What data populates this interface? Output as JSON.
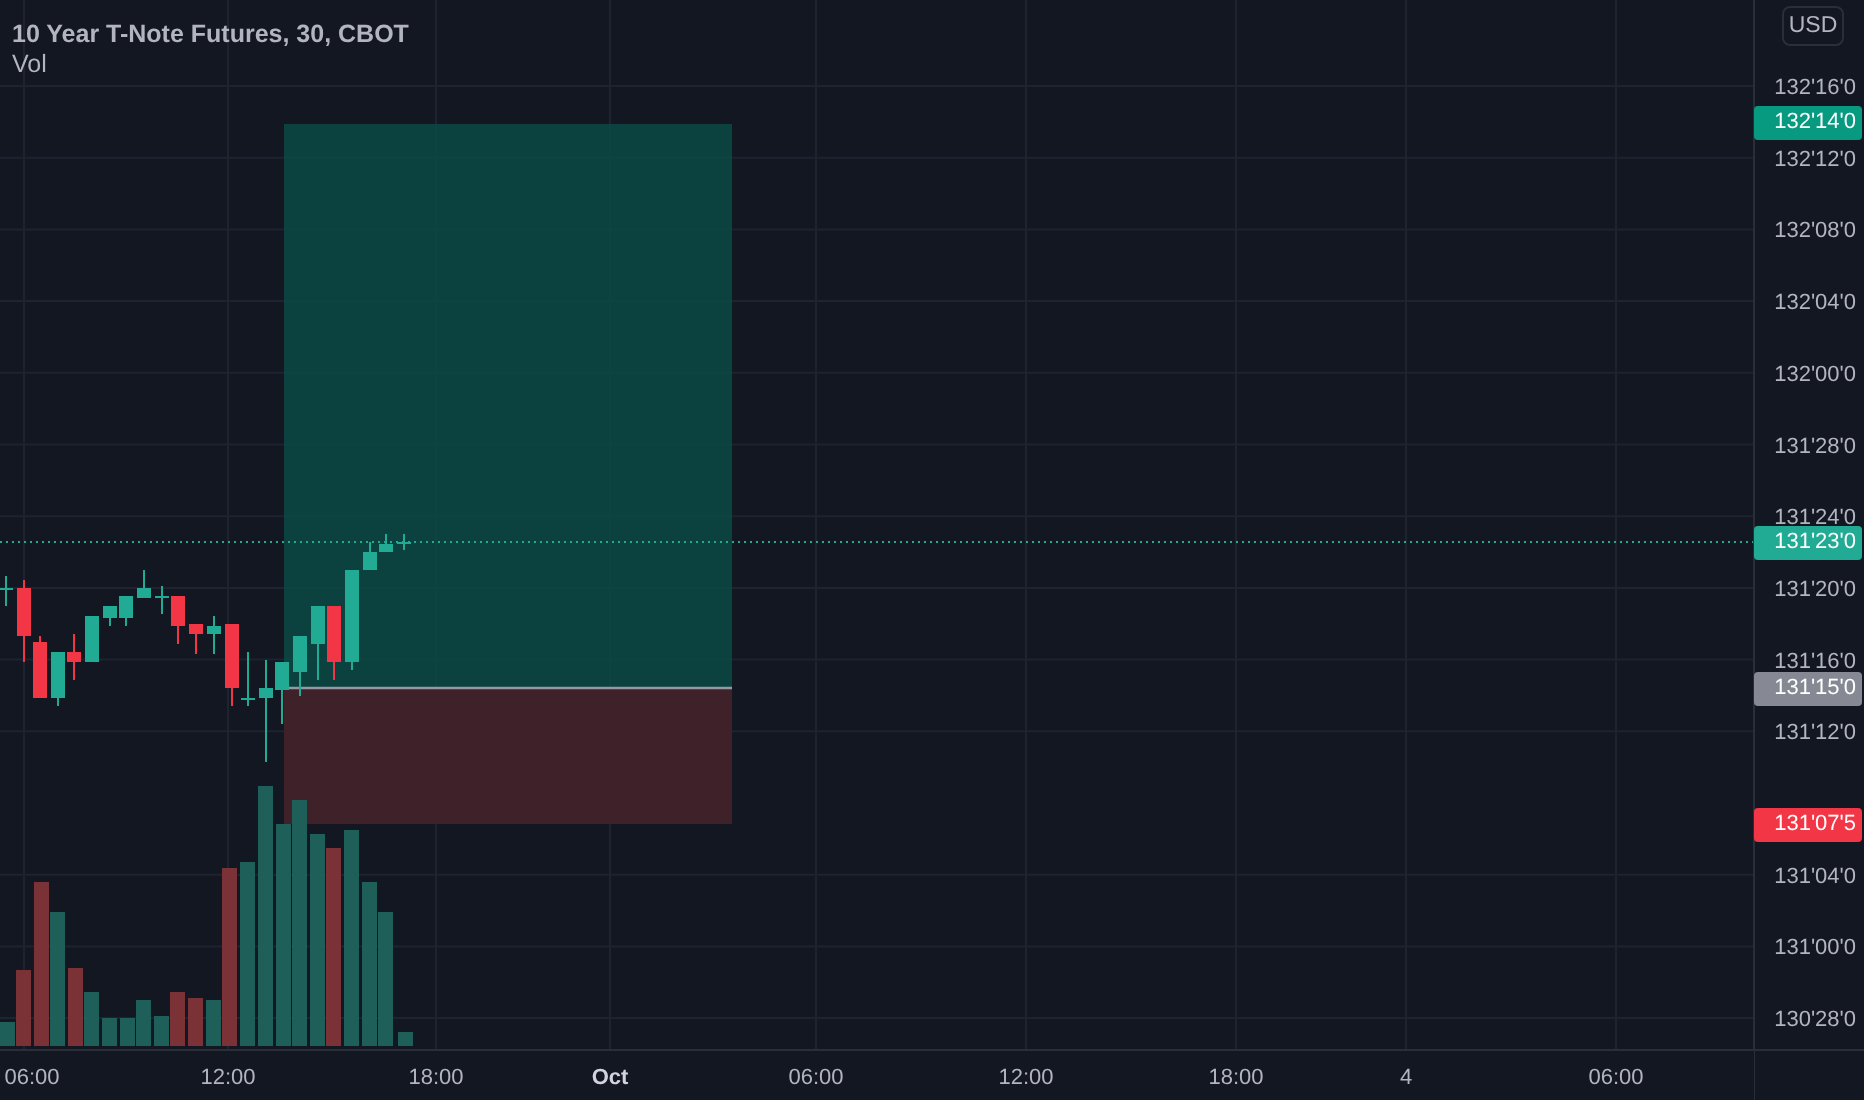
{
  "legend": {
    "title": "10 Year T-Note Futures, 30, CBOT",
    "indicator": "Vol"
  },
  "price_axis": {
    "currency": "USD",
    "ticks": [
      "132'16'0",
      "132'12'0",
      "132'08'0",
      "132'04'0",
      "132'00'0",
      "131'28'0",
      "131'24'0",
      "131'20'0",
      "131'16'0",
      "131'12'0",
      "131'04'0",
      "131'00'0",
      "130'28'0"
    ]
  },
  "price_tags": [
    {
      "text": "132'14'0",
      "kind": "target"
    },
    {
      "text": "131'23'0",
      "kind": "last"
    },
    {
      "text": "131'15'0",
      "kind": "entry"
    },
    {
      "text": "131'07'5",
      "kind": "stop"
    }
  ],
  "time_axis": {
    "labels": [
      {
        "text": "06:00",
        "kind": "time"
      },
      {
        "text": "12:00",
        "kind": "time"
      },
      {
        "text": "18:00",
        "kind": "time"
      },
      {
        "text": "Oct",
        "kind": "month"
      },
      {
        "text": "06:00",
        "kind": "time"
      },
      {
        "text": "12:00",
        "kind": "time"
      },
      {
        "text": "18:00",
        "kind": "time"
      },
      {
        "text": "4",
        "kind": "day"
      },
      {
        "text": "06:00",
        "kind": "time"
      }
    ]
  }
}
